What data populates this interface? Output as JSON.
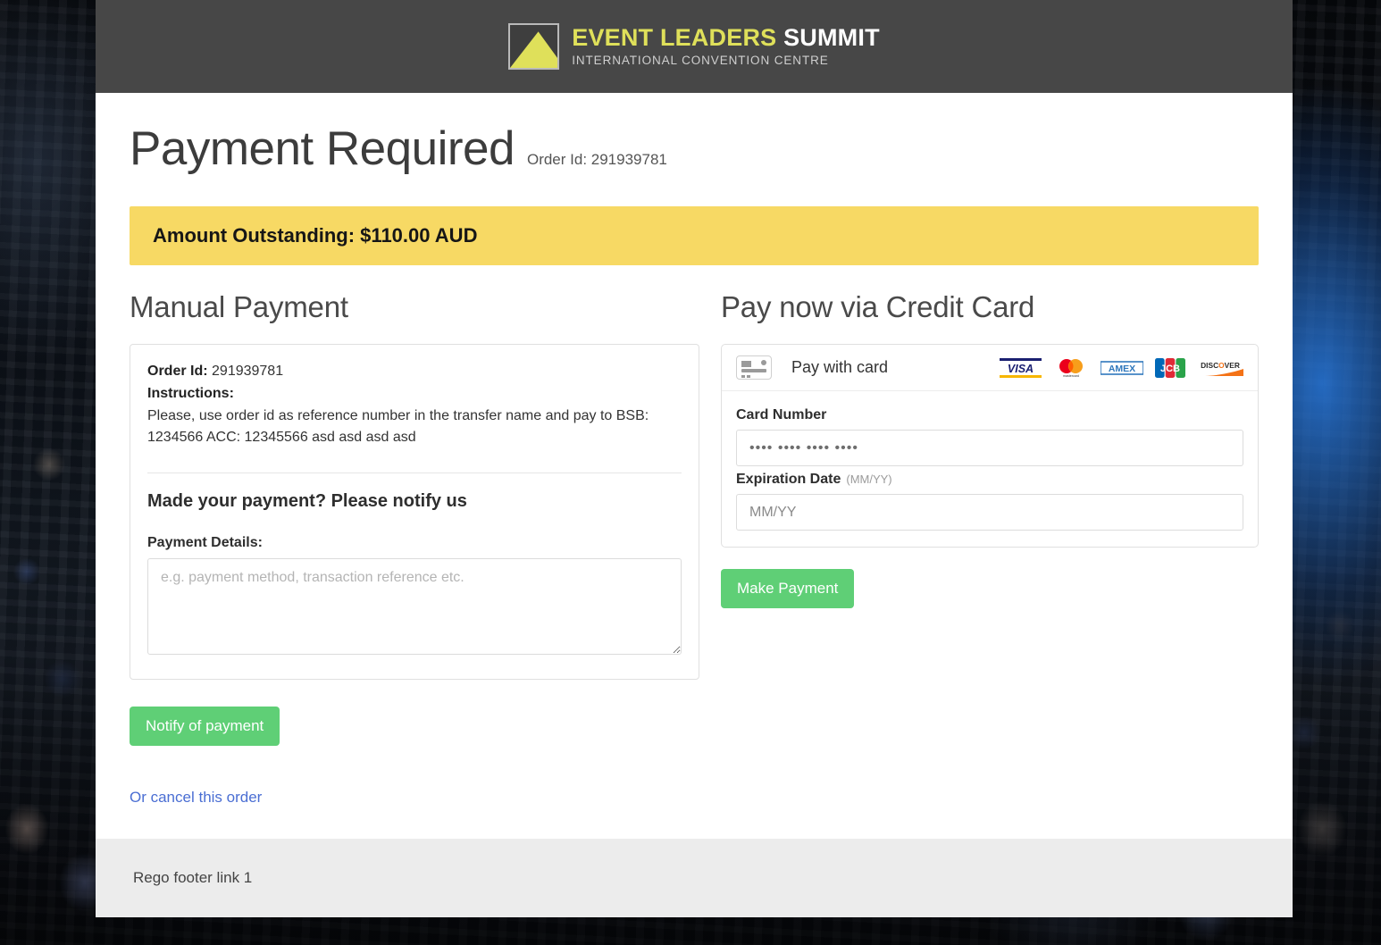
{
  "header": {
    "logo": {
      "icon": "mountain-triangle-logo",
      "title_highlight": "EVENT LEADERS",
      "title_plain": "SUMMIT",
      "subtitle": "INTERNATIONAL CONVENTION CENTRE"
    }
  },
  "page": {
    "title": "Payment Required",
    "order_id_label": "Order Id: 291939781"
  },
  "alert": {
    "text": "Amount Outstanding: $110.00 AUD",
    "bg_color": "#f7d964"
  },
  "manual": {
    "heading": "Manual Payment",
    "order_id_key": "Order Id:",
    "order_id_value": "291939781",
    "instructions_key": "Instructions:",
    "instructions_text": "Please, use order id as reference number in the transfer name and pay to BSB: 1234566 ACC: 12345566 asd asd asd asd",
    "notify_heading": "Made your payment? Please notify us",
    "payment_details_label": "Payment Details:",
    "payment_details_value": "",
    "payment_details_placeholder": "e.g. payment method, transaction reference etc.",
    "notify_button": "Notify of payment",
    "cancel_link": "Or cancel this order"
  },
  "credit_card": {
    "heading": "Pay now via Credit Card",
    "pay_with_card_label": "Pay with card",
    "card_icon": "credit-card-icon",
    "brands": [
      "VISA",
      "mastercard",
      "AMEX",
      "JCB",
      "DISCOVER"
    ],
    "card_number_label": "Card Number",
    "card_number_value": "",
    "card_number_placeholder": "•••• •••• •••• ••••",
    "expiration_label": "Expiration Date",
    "expiration_hint": "(MM/YY)",
    "expiration_value": "",
    "expiration_placeholder": "MM/YY",
    "make_payment_button": "Make Payment",
    "button_color": "#5fcf76"
  },
  "footer": {
    "link_1": "Rego footer link 1"
  }
}
